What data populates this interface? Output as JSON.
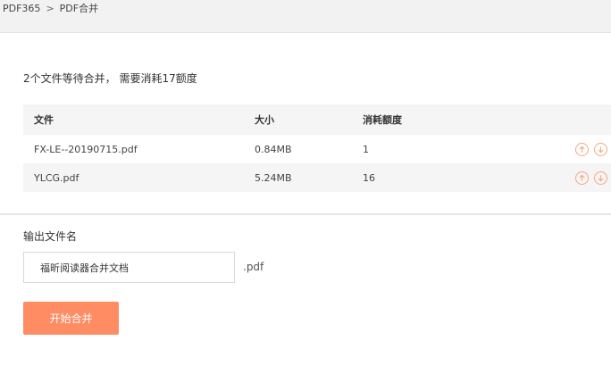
{
  "breadcrumb": {
    "root": "PDF365",
    "separator": ">",
    "current": "PDF合并"
  },
  "summary": "2个文件等待合并， 需要消耗17额度",
  "table": {
    "headers": {
      "name": "文件",
      "size": "大小",
      "cost": "消耗额度"
    },
    "rows": [
      {
        "name": "FX-LE--20190715.pdf",
        "size": "0.84MB",
        "cost": "1"
      },
      {
        "name": "YLCG.pdf",
        "size": "5.24MB",
        "cost": "16"
      }
    ]
  },
  "output": {
    "label": "输出文件名",
    "value": "福昕阅读器合并文档",
    "extension": ".pdf"
  },
  "start_button": "开始合并",
  "colors": {
    "accent": "#ff8c62",
    "arrow": "#f2a982"
  },
  "icons": {
    "move_up": "arrow-up-circle-icon",
    "move_down": "arrow-down-circle-icon"
  }
}
